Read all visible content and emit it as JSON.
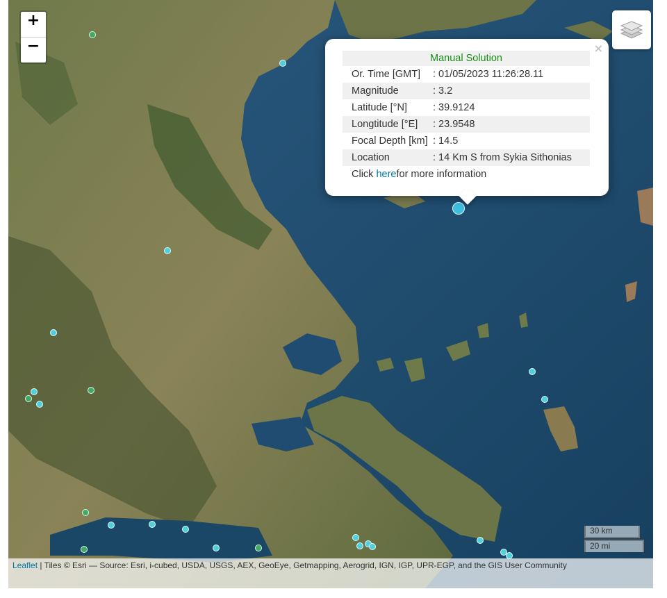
{
  "map": {
    "zoom_in_label": "+",
    "zoom_out_label": "−",
    "layers_icon": "layers-icon",
    "marker_colors": {
      "cyan": "#4fd0dc",
      "green": "#3faa64",
      "selected": "#3fbfe0"
    }
  },
  "popup": {
    "title": "Manual Solution",
    "close_label": "×",
    "rows": [
      {
        "key": "Or. Time [GMT]",
        "value": ": 01/05/2023 11:26:28.11"
      },
      {
        "key": "Magnitude",
        "value": ": 3.2"
      },
      {
        "key": "Latitude [°N]",
        "value": ": 39.9124"
      },
      {
        "key": "Longtitude [°E]",
        "value": ": 23.9548"
      },
      {
        "key": "Focal Depth [km]",
        "value": ": 14.5"
      },
      {
        "key": "Location",
        "value": ": 14 Km S from Sykia Sithonias"
      }
    ],
    "more_prefix": "Click ",
    "more_link": "here",
    "more_suffix": " for more information"
  },
  "scale": {
    "km": "30 km",
    "mi": "20 mi"
  },
  "attribution": {
    "leaflet": "Leaflet",
    "text": " | Tiles © Esri — Source: Esri, i-cubed, USDA, USGS, AEX, GeoEye, Getmapping, Aerogrid, IGN, IGP, UPR-EGP, and the GIS User Community"
  }
}
